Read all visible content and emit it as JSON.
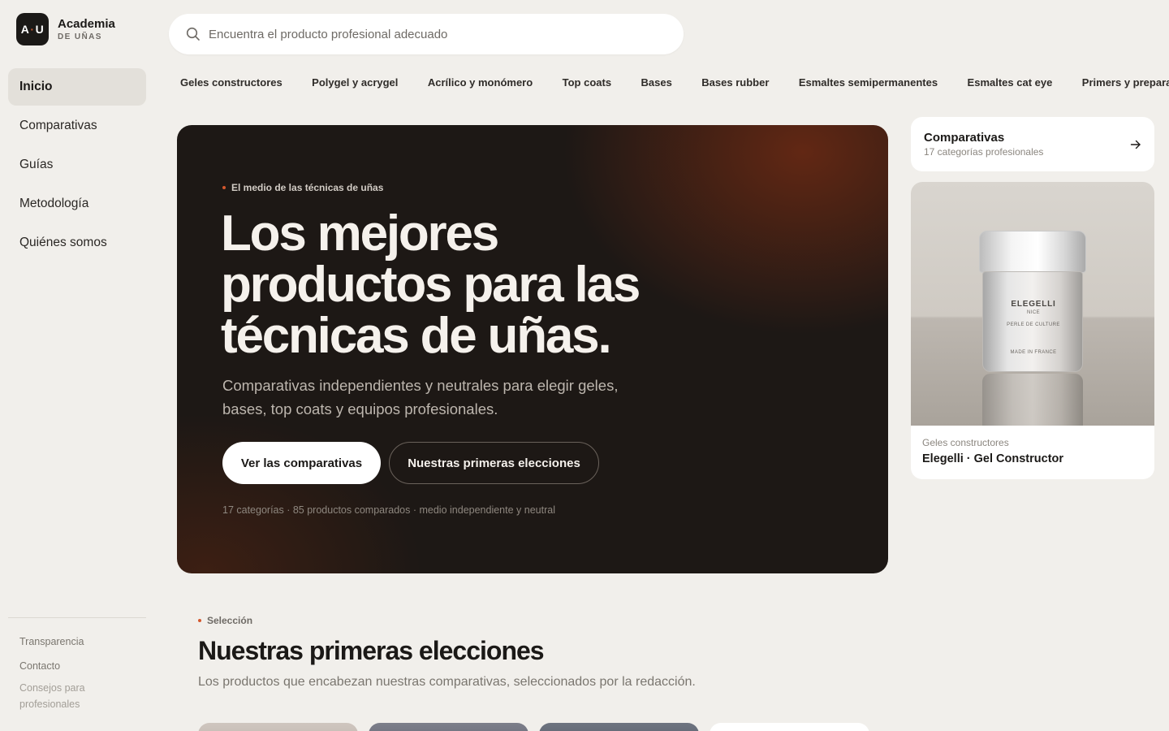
{
  "brand": {
    "logo_left": "A",
    "logo_dot": "·",
    "logo_right": "U",
    "name": "Academia",
    "sub": "DE UÑAS"
  },
  "nav": {
    "items": [
      {
        "label": "Inicio",
        "active": true
      },
      {
        "label": "Comparativas"
      },
      {
        "label": "Guías"
      },
      {
        "label": "Metodología"
      },
      {
        "label": "Quiénes somos"
      }
    ],
    "footer": {
      "transparency": "Transparencia",
      "contact": "Contacto",
      "tips": "Consejos para profesionales"
    }
  },
  "search": {
    "placeholder": "Encuentra el producto profesional adecuado",
    "icon": "search-icon"
  },
  "categories": [
    "Geles constructores",
    "Polygel y acrygel",
    "Acrílico y monómero",
    "Top coats",
    "Bases",
    "Bases rubber",
    "Esmaltes semipermanentes",
    "Esmaltes cat eye",
    "Primers y preparación"
  ],
  "hero": {
    "eyebrow": "El medio de las técnicas de uñas",
    "title": "Los mejores productos para las técnicas de uñas.",
    "subtitle": "Comparativas independientes y neutrales para elegir geles, bases, top coats y equipos profesionales.",
    "primary_cta": "Ver las comparativas",
    "secondary_cta": "Nuestras primeras elecciones",
    "meta": "17 categorías · 85 productos comparados · medio independiente y neutral"
  },
  "compare_card": {
    "title": "Comparativas",
    "subtitle": "17 categorías profesionales",
    "icon": "arrow-right-icon"
  },
  "featured_product": {
    "category": "Geles constructores",
    "name": "Elegelli · Gel Constructor",
    "jar_brand": "ELEGELLI",
    "jar_sub": "NICE",
    "jar_line1": "PERLE DE CULTURE",
    "jar_line2": "MADE IN FRANCE"
  },
  "selection": {
    "eyebrow": "Selección",
    "title": "Nuestras primeras elecciones",
    "subtitle": "Los productos que encabezan nuestras comparativas, seleccionados por la redacción."
  },
  "colors": {
    "accent": "#d4572d",
    "background": "#f1efeb",
    "hero": "#1d1815",
    "ink": "#1b1917"
  }
}
